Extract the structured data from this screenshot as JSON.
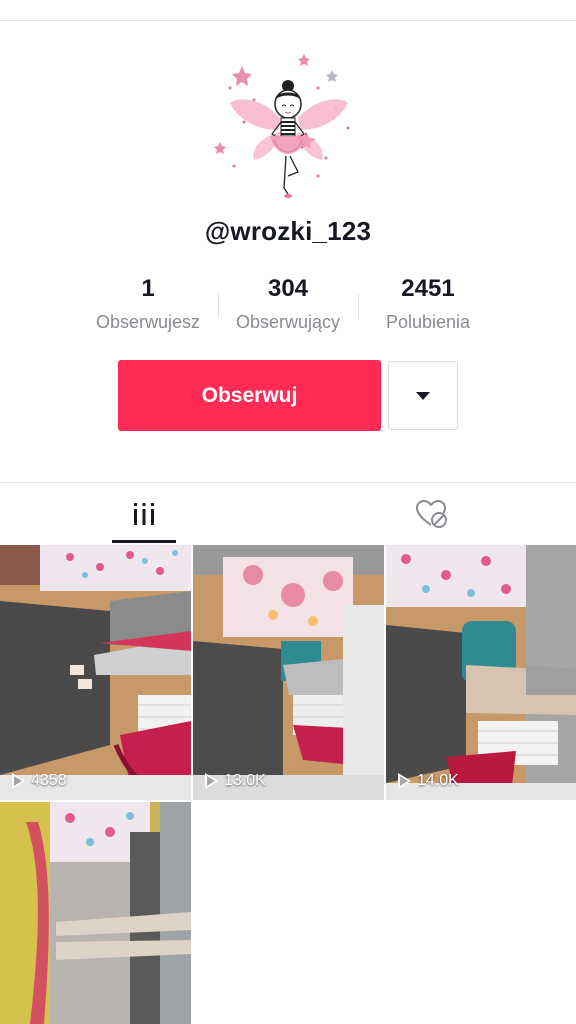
{
  "profile": {
    "username": "@wrozki_123"
  },
  "stats": [
    {
      "value": "1",
      "label": "Obserwujesz"
    },
    {
      "value": "304",
      "label": "Obserwujący"
    },
    {
      "value": "2451",
      "label": "Polubienia"
    }
  ],
  "actions": {
    "follow_label": "Obserwuj"
  },
  "tabs": [
    {
      "icon": "video-grid-icon",
      "active": true
    },
    {
      "icon": "liked-heart-hidden-icon",
      "active": false
    }
  ],
  "videos": [
    {
      "views": "4358"
    },
    {
      "views": "13.0K"
    },
    {
      "views": "14.0K"
    },
    {
      "views": ""
    }
  ],
  "colors": {
    "accent": "#fe2c55",
    "text": "#161823",
    "muted": "#8a8b91"
  }
}
